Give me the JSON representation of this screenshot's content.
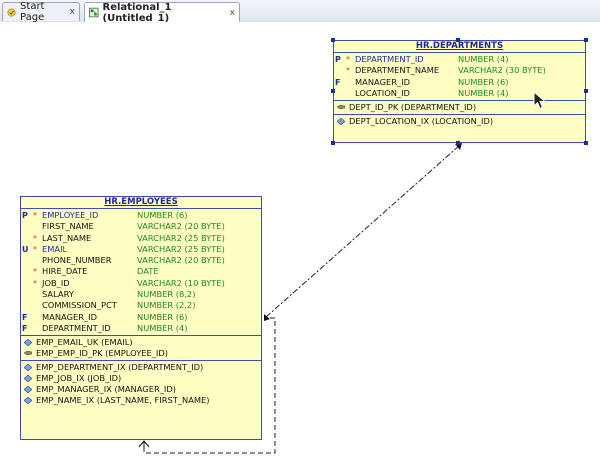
{
  "tabs": [
    {
      "label": "Start Page",
      "close": "x",
      "active": false
    },
    {
      "label": "Relational_1 (Untitled_1)",
      "close": "x",
      "active": true
    }
  ],
  "tables": {
    "departments": {
      "title": "HR.DEPARTMENTS",
      "columns": [
        {
          "flag": "P",
          "star": "*",
          "name": "DEPARTMENT_ID",
          "type": "NUMBER (4)",
          "key": true
        },
        {
          "flag": "",
          "star": "*",
          "name": "DEPARTMENT_NAME",
          "type": "VARCHAR2 (30 BYTE)",
          "key": false
        },
        {
          "flag": "F",
          "star": "",
          "name": "MANAGER_ID",
          "type": "NUMBER (6)",
          "key": false
        },
        {
          "flag": "",
          "star": "",
          "name": "LOCATION_ID",
          "type": "NUMBER (4)",
          "key": false
        }
      ],
      "keys": [
        {
          "icon": "pk",
          "text": "DEPT_ID_PK (DEPARTMENT_ID)"
        }
      ],
      "indexes": [
        {
          "icon": "index",
          "text": "DEPT_LOCATION_IX (LOCATION_ID)"
        }
      ]
    },
    "employees": {
      "title": "HR.EMPLOYEES",
      "columns": [
        {
          "flag": "P",
          "star": "*",
          "name": "EMPLOYEE_ID",
          "type": "NUMBER (6)",
          "key": true
        },
        {
          "flag": "",
          "star": "",
          "name": "FIRST_NAME",
          "type": "VARCHAR2 (20 BYTE)",
          "key": false
        },
        {
          "flag": "",
          "star": "*",
          "name": "LAST_NAME",
          "type": "VARCHAR2 (25 BYTE)",
          "key": false
        },
        {
          "flag": "U",
          "star": "*",
          "name": "EMAIL",
          "type": "VARCHAR2 (25 BYTE)",
          "key": true
        },
        {
          "flag": "",
          "star": "",
          "name": "PHONE_NUMBER",
          "type": "VARCHAR2 (20 BYTE)",
          "key": false
        },
        {
          "flag": "",
          "star": "*",
          "name": "HIRE_DATE",
          "type": "DATE",
          "key": false
        },
        {
          "flag": "",
          "star": "*",
          "name": "JOB_ID",
          "type": "VARCHAR2 (10 BYTE)",
          "key": false
        },
        {
          "flag": "",
          "star": "",
          "name": "SALARY",
          "type": "NUMBER (8,2)",
          "key": false
        },
        {
          "flag": "",
          "star": "",
          "name": "COMMISSION_PCT",
          "type": "NUMBER (2,2)",
          "key": false
        },
        {
          "flag": "F",
          "star": "",
          "name": "MANAGER_ID",
          "type": "NUMBER (6)",
          "key": false
        },
        {
          "flag": "F",
          "star": "",
          "name": "DEPARTMENT_ID",
          "type": "NUMBER (4)",
          "key": false
        }
      ],
      "keys": [
        {
          "icon": "uk",
          "text": "EMP_EMAIL_UK (EMAIL)"
        },
        {
          "icon": "pk",
          "text": "EMP_EMP_ID_PK (EMPLOYEE_ID)"
        }
      ],
      "indexes": [
        {
          "icon": "index",
          "text": "EMP_DEPARTMENT_IX (DEPARTMENT_ID)"
        },
        {
          "icon": "index",
          "text": "EMP_JOB_IX (JOB_ID)"
        },
        {
          "icon": "index",
          "text": "EMP_MANAGER_IX (MANAGER_ID)"
        },
        {
          "icon": "index",
          "text": "EMP_NAME_IX (LAST_NAME, FIRST_NAME)"
        }
      ]
    }
  },
  "colors": {
    "table_fill": "#ffffc4",
    "table_border": "#3c4fb0",
    "column_type": "#1e8a1e",
    "mandatory_star": "#d43a2a",
    "key_text": "#1d2c9a"
  }
}
